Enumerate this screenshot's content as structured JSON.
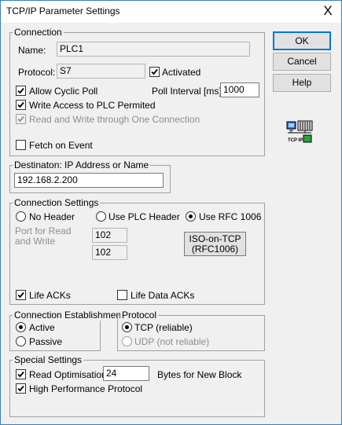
{
  "window": {
    "title": "TCP/IP Parameter Settings",
    "close": "X"
  },
  "buttons": {
    "ok": "OK",
    "cancel": "Cancel",
    "help": "Help"
  },
  "connection": {
    "title": "Connection",
    "name_label": "Name:",
    "name_value": "PLC1",
    "protocol_label": "Protocol:",
    "protocol_value": "S7",
    "activated": {
      "label": "Activated",
      "checked": true
    },
    "allow_cyclic_poll": {
      "label": "Allow Cyclic Poll",
      "checked": true
    },
    "poll_interval_label": "Poll Interval [ms]:",
    "poll_interval_value": "1000",
    "write_access": {
      "label": "Write Access to PLC Permited",
      "checked": true
    },
    "read_write_one": {
      "label": "Read and Write through One Connection",
      "checked": true,
      "disabled": true
    },
    "fetch_on_event": {
      "label": "Fetch on Event",
      "checked": false
    }
  },
  "destination": {
    "title": "Destinaton: IP Address or Name",
    "value": "192.168.2.200"
  },
  "settings": {
    "title": "Connection Settings",
    "no_header": "No Header",
    "use_plc_header": "Use PLC Header",
    "use_rfc": "Use RFC 1006",
    "selected": "use_rfc",
    "port_label": "Port for Read and Write",
    "port_read": "102",
    "port_write": "102",
    "iso_button_line1": "ISO-on-TCP",
    "iso_button_line2": "(RFC1006)",
    "life_acks": {
      "label": "Life ACKs",
      "checked": true
    },
    "life_data_acks": {
      "label": "Life Data ACKs",
      "checked": false
    }
  },
  "establishment": {
    "title": "Connection Establishment",
    "active": "Active",
    "passive": "Passive",
    "selected": "active"
  },
  "protocol": {
    "title": "Protocol",
    "tcp": "TCP (reliable)",
    "udp": "UDP (not reliable)",
    "selected": "tcp"
  },
  "special": {
    "title": "Special Settings",
    "read_opt": {
      "label": "Read Optimisation",
      "checked": true
    },
    "read_opt_value": "24",
    "bytes_label": "Bytes for New Block",
    "high_perf": {
      "label": "High Performance Protocol",
      "checked": true
    }
  },
  "icons": {
    "tcpip_label": "TCP IP"
  }
}
